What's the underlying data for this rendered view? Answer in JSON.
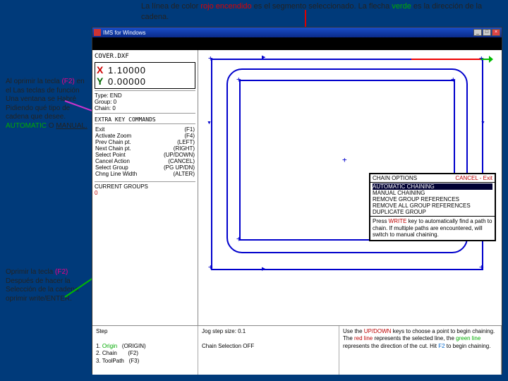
{
  "top_caption": {
    "pre": "La línea de color ",
    "red": "rojo encendido",
    "mid": " es el segmento seleccionado. La flecha ",
    "green": "verde",
    "post": " es la dirección de la cadena."
  },
  "left1": {
    "a": "Al oprimir la tecla ",
    "f2": "(F2)",
    "b": " en el Las teclas de función Una ventana se Habré Pidiendo qué tipo de cadena que desee. ",
    "auto": "AUTOMATIC",
    "or": " O ",
    "man": "MANUAL."
  },
  "left2": {
    "a": "Oprimir la tecla  ",
    "f2": "(F2)",
    "b": " Después de hacer la Selección de la cadena oprimir write/ENTER."
  },
  "window": {
    "title": "IMS for Windows",
    "min": "_",
    "max": "□",
    "close": "×",
    "topbar": ""
  },
  "file": "COVER.DXF",
  "coords": {
    "xlbl": "X",
    "xval": "1.10000",
    "ylbl": "Y",
    "yval": "0.00000"
  },
  "meta": {
    "type": "Type:  END",
    "group": "Group:    0",
    "chain": "Chain:    0"
  },
  "keys_header": "EXTRA KEY COMMANDS",
  "keys": [
    {
      "l": "Exit",
      "r": "(F1)"
    },
    {
      "l": "Activate Zoom",
      "r": "(F4)"
    },
    {
      "l": "Prev Chain pt.",
      "r": "(LEFT)"
    },
    {
      "l": "Next Chain pt.",
      "r": "(RIGHT)"
    },
    {
      "l": "Select Point",
      "r": "(UP/DOWN)"
    },
    {
      "l": "Cancel Action",
      "r": "(CANCEL)"
    },
    {
      "l": "Select Group",
      "r": "(PG UP/DN)"
    },
    {
      "l": "Chng Line Width",
      "r": "(ALTER)"
    }
  ],
  "cgroups": {
    "h": "CURRENT GROUPS",
    "v": "0"
  },
  "popup": {
    "title": "CHAIN OPTIONS",
    "cancel": "CANCEL - Exit",
    "opts": [
      {
        "t": "AUTOMATIC CHAINING",
        "sel": true
      },
      {
        "t": "MANUAL CHAINING",
        "sel": false
      },
      {
        "t": "REMOVE GROUP REFERENCES",
        "sel": false
      },
      {
        "t": "REMOVE ALL GROUP REFERENCES",
        "sel": false
      },
      {
        "t": "DUPLICATE GROUP",
        "sel": false
      }
    ],
    "msg_pre": "Press ",
    "msg_wr": "WRITE",
    "msg_post": " key to automatically find a path to chain. If multiple paths are encountered, will switch to manual chaining."
  },
  "bottom": {
    "step": "Step",
    "items": [
      {
        "n": "1.",
        "t": "Origin",
        "k": "(ORIGIN)",
        "cls": "origin"
      },
      {
        "n": "2.",
        "t": "Chain",
        "k": "(F2)"
      },
      {
        "n": "3.",
        "t": "ToolPath",
        "k": "(F3)"
      }
    ],
    "jog": "Jog step size: 0.1",
    "csel": "Chain Selection OFF",
    "hint_pre": "Use the ",
    "hint_up": "UP/DOWN",
    "hint_a": " keys to choose a point to begin chaining. The ",
    "hint_red": "red line",
    "hint_b": " represents the selected line, the ",
    "hint_grn": "green line",
    "hint_c": " represents the direction of the cut. Hit ",
    "hint_f2": "F2",
    "hint_d": " to begin chaining."
  }
}
